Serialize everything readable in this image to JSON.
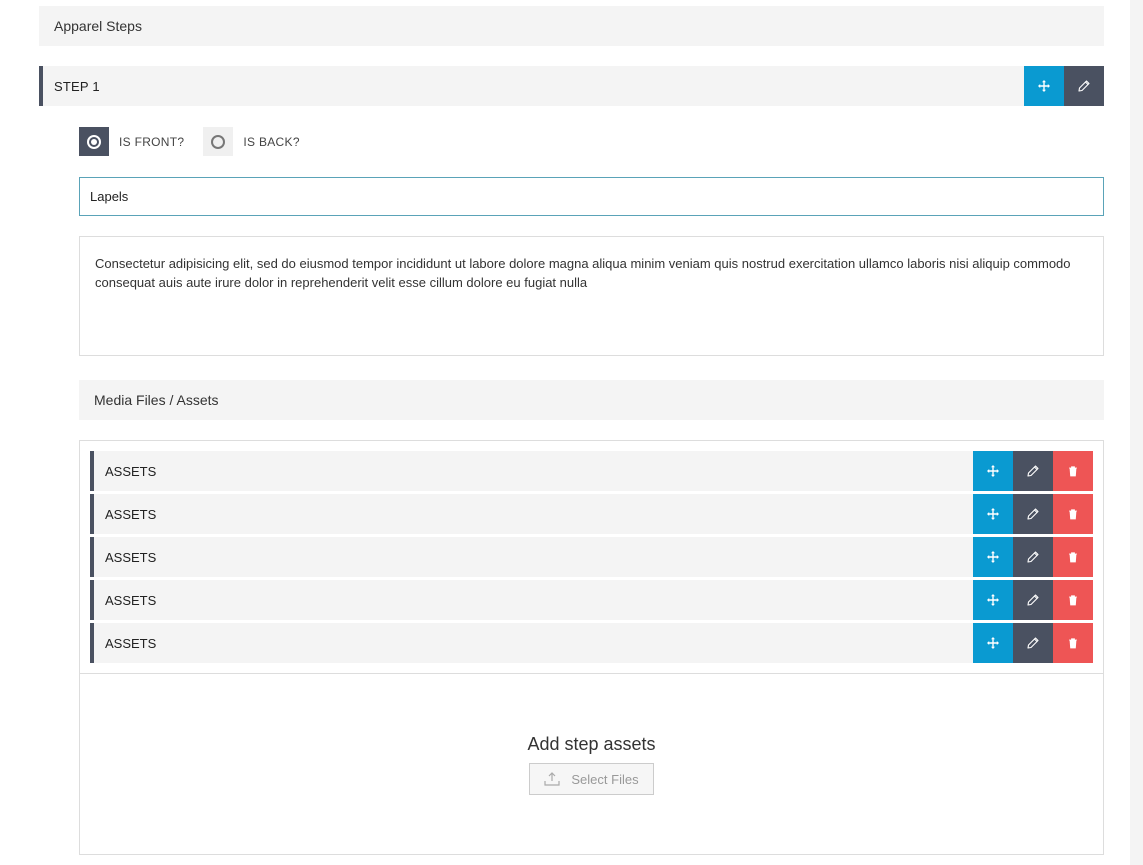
{
  "section": {
    "title": "Apparel Steps"
  },
  "step": {
    "label": "STEP 1"
  },
  "side_options": [
    {
      "label": "IS FRONT?",
      "selected": true
    },
    {
      "label": "IS BACK?",
      "selected": false
    }
  ],
  "step_name": {
    "value": "Lapels"
  },
  "description": {
    "value": "Consectetur adipisicing elit, sed do eiusmod tempor incididunt ut labore dolore magna aliqua minim veniam quis nostrud exercitation ullamco laboris nisi aliquip commodo consequat auis aute irure dolor in reprehenderit velit esse cillum dolore eu fugiat nulla"
  },
  "media": {
    "title": "Media Files / Assets",
    "assets": [
      {
        "label": "ASSETS"
      },
      {
        "label": "ASSETS"
      },
      {
        "label": "ASSETS"
      },
      {
        "label": "ASSETS"
      },
      {
        "label": "ASSETS"
      }
    ],
    "add_title": "Add step assets",
    "select_label": "Select Files"
  },
  "colors": {
    "accent": "#0a9ad1",
    "dark": "#4a5161",
    "danger": "#ee5555"
  },
  "icons": {
    "move": "move-icon",
    "edit": "pencil-icon",
    "delete": "trash-icon",
    "upload": "upload-icon"
  }
}
